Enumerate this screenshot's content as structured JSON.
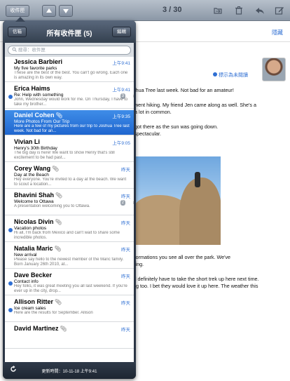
{
  "toolbar": {
    "mailbox_button": "收件匣",
    "counter": "3 / 30",
    "up_icon": "up-arrow-icon",
    "down_icon": "down-arrow-icon",
    "folder_icon": "folder-icon",
    "trash_icon": "trash-icon",
    "reply_icon": "reply-icon",
    "compose_icon": "compose-icon"
  },
  "message": {
    "hide_link": "隱藏",
    "mark_unread": "標示為未閱讀",
    "lines": [
      "oshua Tree last week. Not bad for an amateur!",
      "e went hiking. My friend Jen came along as well. She's a",
      "e a lot in common.",
      "e got there as the sun was going down.",
      "s spectacular.",
      "k formations you see all over the park. We've",
      "azing.",
      "e'll definitely have to take the short trek up here next time.",
      "ong too. I bet they would love it up here. The weather this"
    ]
  },
  "popover": {
    "back_button": "信箱",
    "title": "所有收件匣 (5)",
    "edit_button": "編輯",
    "search_placeholder": "搜尋：收件匣",
    "footer_text": "更新時間：10-11-18 上午9:41",
    "refresh_icon": "refresh-icon"
  },
  "emails": [
    {
      "sender": "Jessica Barbieri",
      "time": "上午9:41",
      "subject": "My five favorite parks",
      "preview": "These are the best of the best. You can't go wrong. Each one is amazing in its own way.",
      "unread": false,
      "selected": false,
      "attachment": false,
      "thread": ""
    },
    {
      "sender": "Erica Haims",
      "time": "上午9:41",
      "subject": "Re: Help with something",
      "preview": "John, Wednesday would work for me. On Thursday, I have to take my brother...",
      "unread": true,
      "selected": false,
      "attachment": false,
      "thread": "3"
    },
    {
      "sender": "Daniel Cohen",
      "time": "上午9:35",
      "subject": "More Photos From Our Trip",
      "preview": "Here are a few of my pictures from our trip to Joshua Tree last week. Not bad for an...",
      "unread": false,
      "selected": true,
      "attachment": true,
      "thread": ""
    },
    {
      "sender": "Vivian Li",
      "time": "上午9:05",
      "subject": "Henry's 30th Birthday",
      "preview": "The big day is here! We want to show Henry that's still excitement to be had past...",
      "unread": false,
      "selected": false,
      "attachment": false,
      "thread": ""
    },
    {
      "sender": "Corey Wang",
      "time": "昨天",
      "subject": "Day at the Beach",
      "preview": "Hey everyone. You're invited to a day at the beach. We want to scout a location...",
      "unread": false,
      "selected": false,
      "attachment": true,
      "thread": ""
    },
    {
      "sender": "Bhavini Shah",
      "time": "昨天",
      "subject": "Welcome to Ottawa",
      "preview": "A presentation welcoming you to Ottawa.",
      "unread": false,
      "selected": false,
      "attachment": true,
      "thread": "2"
    },
    {
      "sender": "Nicolas Divin",
      "time": "昨天",
      "subject": "Vacation photos",
      "preview": "Hi all, I'm back from Mexico and can't wait to share some incredible photos.",
      "unread": true,
      "selected": false,
      "attachment": true,
      "thread": ""
    },
    {
      "sender": "Natalia Maric",
      "time": "昨天",
      "subject": "New arrival",
      "preview": "Please say hello to the newest member of the Maric family. Born January 26th 2010, at...",
      "unread": false,
      "selected": false,
      "attachment": true,
      "thread": ""
    },
    {
      "sender": "Dave Becker",
      "time": "昨天",
      "subject": "Contact info",
      "preview": "Hey folks, it was great meeting you all last weekend. If you're ever up in the city, drop...",
      "unread": true,
      "selected": false,
      "attachment": false,
      "thread": ""
    },
    {
      "sender": "Allison Ritter",
      "time": "昨天",
      "subject": "Ice cream sales",
      "preview": "Here are the results for September. Allison",
      "unread": true,
      "selected": false,
      "attachment": true,
      "thread": ""
    },
    {
      "sender": "David Martinez",
      "time": "昨天",
      "subject": "",
      "preview": "",
      "unread": false,
      "selected": false,
      "attachment": true,
      "thread": ""
    }
  ]
}
